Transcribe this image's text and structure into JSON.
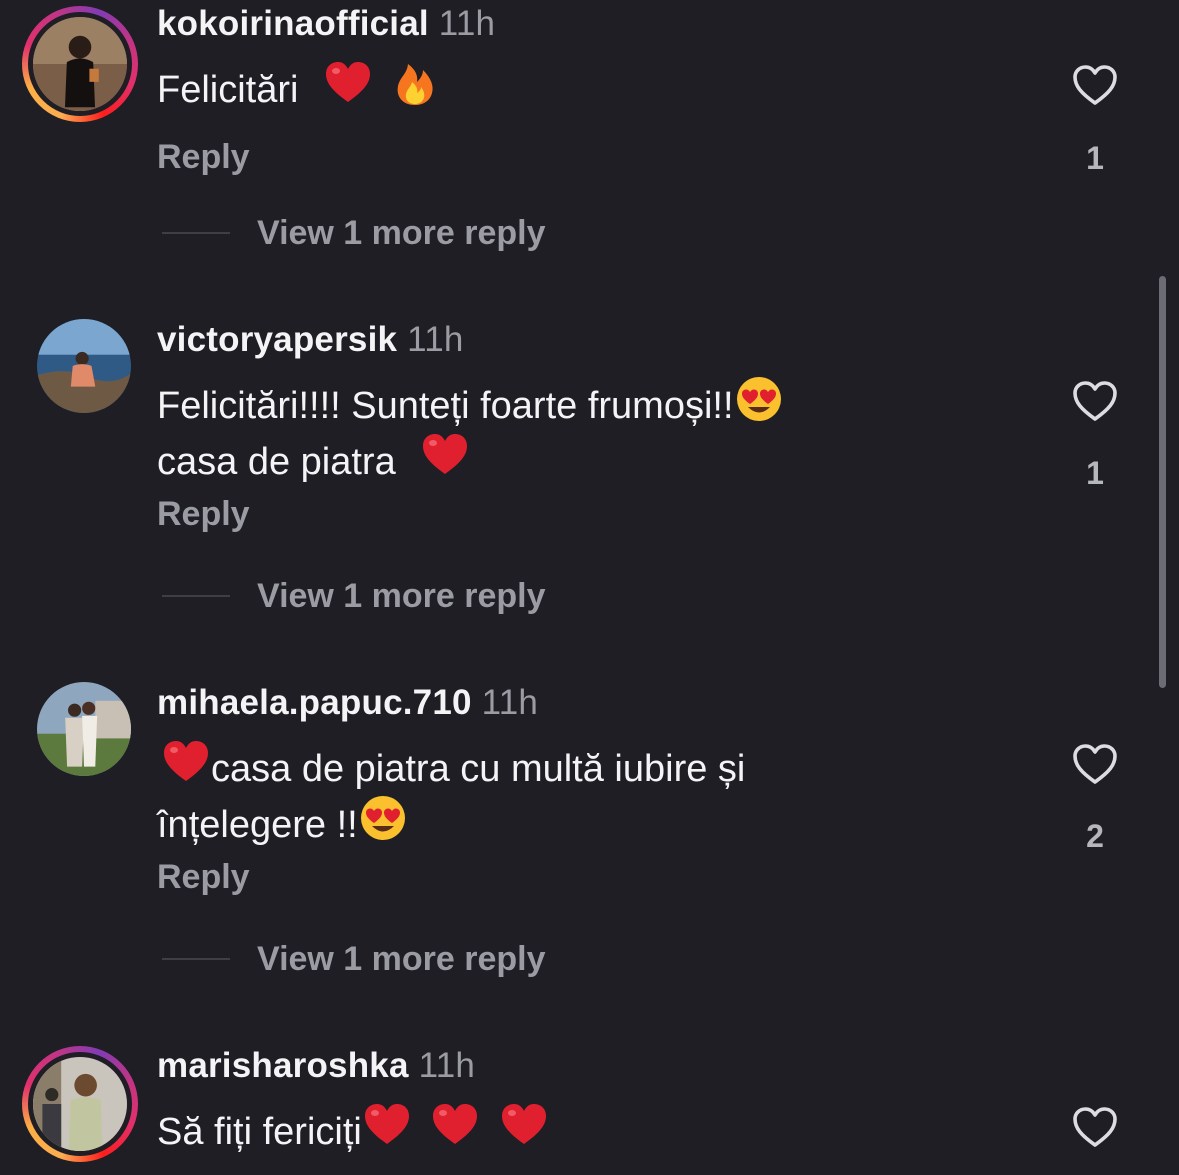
{
  "comments": [
    {
      "username": "kokoirinaofficial",
      "time": "11h",
      "text_line1": "Felicitări",
      "text_line2": "",
      "reply_label": "Reply",
      "likes": "1",
      "view_more": "View 1 more reply",
      "avatar_story_ring": true
    },
    {
      "username": "victoryapersik",
      "time": "11h",
      "text_line1": "Felicitări!!!! Sunteți foarte frumoși!!",
      "text_line2": "casa de piatra",
      "reply_label": "Reply",
      "likes": "1",
      "view_more": "View 1 more reply",
      "avatar_story_ring": false
    },
    {
      "username": "mihaela.papuc.710",
      "time": "11h",
      "text_line1": "casa de piatra cu multă iubire și",
      "text_line2": "înțelegere !!",
      "reply_label": "Reply",
      "likes": "2",
      "view_more": "View 1 more reply",
      "avatar_story_ring": false
    },
    {
      "username": "marisharoshka",
      "time": "11h",
      "text_line1": "Să fiți fericiți",
      "text_line2": "",
      "reply_label": "",
      "likes": "",
      "view_more": "",
      "avatar_story_ring": true
    }
  ],
  "icons": {
    "like": "heart-outline-icon",
    "emoji_heart": "red-heart-emoji",
    "emoji_fire": "fire-emoji",
    "emoji_heart_eyes": "heart-eyes-emoji"
  },
  "colors": {
    "background": "#1e1e24",
    "primary_text": "#f4f4f6",
    "secondary_text": "#9b9ba3",
    "heart_emoji": "#e0202e"
  }
}
